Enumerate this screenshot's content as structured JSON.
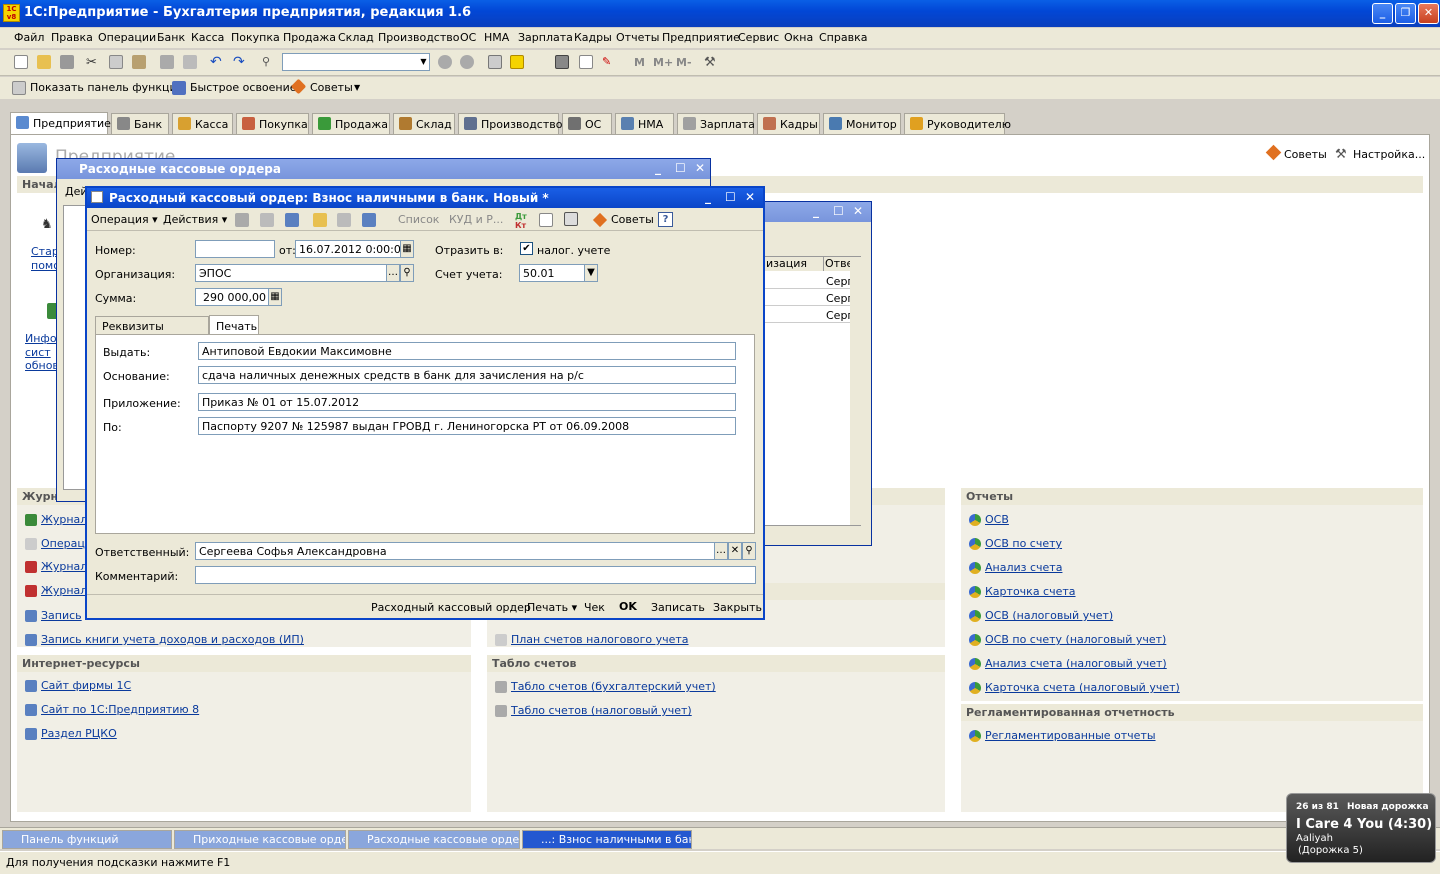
{
  "app": {
    "title": "1С:Предприятие - Бухгалтерия предприятия, редакция 1.6",
    "logo": "1С v8"
  },
  "menu": [
    "Файл",
    "Правка",
    "Операции",
    "Банк",
    "Касса",
    "Покупка",
    "Продажа",
    "Склад",
    "Производство",
    "ОС",
    "НМА",
    "Зарплата",
    "Кадры",
    "Отчеты",
    "Предприятие",
    "Сервис",
    "Окна",
    "Справка"
  ],
  "toolbar2": {
    "show_panel": "Показать панель функций",
    "quick_learn": "Быстрое освоение",
    "tips": "Советы"
  },
  "tabs": [
    "Предприятие",
    "Банк",
    "Касса",
    "Покупка",
    "Продажа",
    "Склад",
    "Производство",
    "ОС",
    "НМА",
    "Зарплата",
    "Кадры",
    "Монитор",
    "Руководителю"
  ],
  "panel": {
    "title": "Предприятие",
    "tips": "Советы",
    "settings": "Настройка...",
    "start_head": "Начал",
    "start_links": [
      "Старт",
      "помо",
      "Инфор",
      "сист",
      "обнов."
    ],
    "journals_head": "Журна",
    "journal_links": [
      "Журнал",
      "Операц",
      "Журнал",
      "Журнал",
      "Запись"
    ],
    "book_link": "Запись книги учета доходов и расходов (ИП)",
    "internet_head": "Интернет-ресурсы",
    "internet_links": [
      "Сайт фирмы 1С",
      "Сайт по 1С:Предприятию 8",
      "Раздел РЦКО"
    ],
    "plan_link": "План счетов налогового учета",
    "tablo_head": "Табло счетов",
    "tablo_links": [
      "Табло счетов (бухгалтерский учет)",
      "Табло счетов (налоговый учет)"
    ],
    "reports_head": "Отчеты",
    "report_links": [
      "ОСВ",
      "ОСВ по счету",
      "Анализ счета",
      "Карточка счета",
      "ОСВ (налоговый учет)",
      "ОСВ по счету (налоговый учет)",
      "Анализ счета (налоговый учет)",
      "Карточка счета (налоговый учет)"
    ],
    "reg_head": "Регламентированная отчетность",
    "reg_links": [
      "Регламентированные отчеты"
    ]
  },
  "list_window": {
    "title": "Расходные кассовые ордера",
    "action_label": "Дей",
    "col1": "изация",
    "col2": "Отве",
    "rows": [
      "Серг",
      "Серг",
      "Серг"
    ]
  },
  "dialog": {
    "title": "Расходный кассовый ордер: Взнос наличными в банк. Новый *",
    "toolbar": {
      "operation": "Операция",
      "actions": "Действия",
      "list": "Список",
      "kud": "КУД и Р...",
      "tips": "Советы"
    },
    "number_label": "Номер:",
    "number": "",
    "from_label": "от:",
    "date": "16.07.2012  0:00:00",
    "reflect_label": "Отразить в:",
    "tax_label": "налог. учете",
    "org_label": "Организация:",
    "org": "ЭПОС",
    "account_label": "Счет учета:",
    "account": "50.01",
    "sum_label": "Сумма:",
    "sum": "290 000,00",
    "tabs": [
      "Реквизиты платежа",
      "Печать"
    ],
    "issue_label": "Выдать:",
    "issue": "Антиповой Евдокии Максимовне",
    "basis_label": "Основание:",
    "basis": "сдача наличных денежных средств в банк для зачисления на р/с",
    "attach_label": "Приложение:",
    "attach": "Приказ № 01 от 15.07.2012",
    "by_label": "По:",
    "by": "Паспорту 9207 № 125987 выдан ГРОВД г. Лениногорска РТ от 06.09.2008",
    "resp_label": "Ответственный:",
    "resp": "Сергеева Софья Александровна",
    "comment_label": "Комментарий:",
    "comment": "",
    "bottom": {
      "print_form": "Расходный кассовый ордер",
      "print": "Печать",
      "check": "Чек",
      "ok": "OK",
      "save": "Записать",
      "close": "Закрыть"
    }
  },
  "taskbar": [
    "Панель функций",
    "Приходные кассовые ордера",
    "Расходные кассовые ордера",
    "...: Взнос наличными в бан..."
  ],
  "status": "Для получения подсказки нажмите F1",
  "notification": {
    "track": "26 из 81",
    "new_track": "Новая дорожка",
    "song": "I Care 4 You (4:30)",
    "artist": "Aaliyah",
    "track_no": "(Дорожка 5)"
  }
}
